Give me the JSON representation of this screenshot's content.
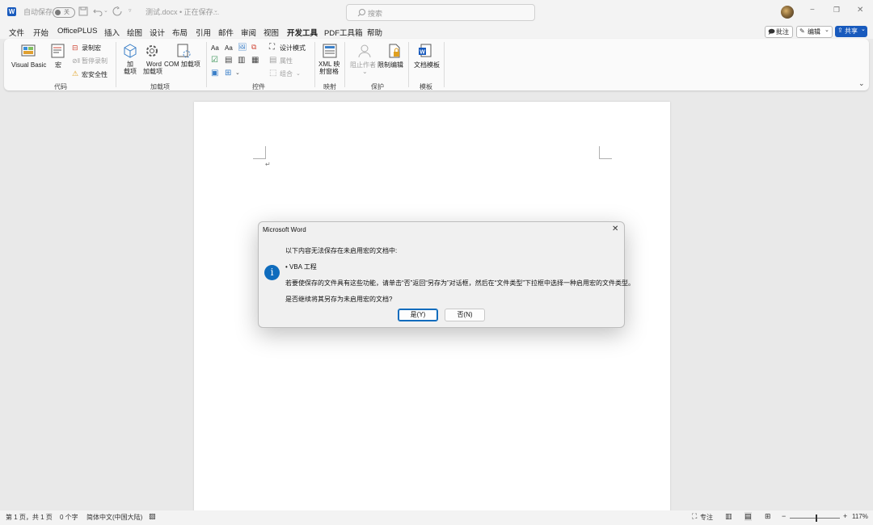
{
  "titlebar": {
    "autosave_label": "自动保存",
    "autosave_state": "关",
    "document_title": "测试.docx • 正在保存...",
    "search_placeholder": "搜索",
    "minimize": "−",
    "restore": "❐",
    "close": "✕"
  },
  "menu": {
    "tabs": [
      "文件",
      "开始",
      "OfficePLUS",
      "插入",
      "绘图",
      "设计",
      "布局",
      "引用",
      "邮件",
      "审阅",
      "视图",
      "开发工具",
      "PDF工具箱",
      "帮助"
    ],
    "active_tab": "开发工具",
    "comments_label": "批注",
    "edit_label": "编辑",
    "share_label": "共享"
  },
  "ribbon": {
    "code": {
      "label": "代码",
      "visual_basic": "Visual Basic",
      "macros": "宏",
      "record_macro": "录制宏",
      "pause_recording": "暂停录制",
      "macro_security": "宏安全性"
    },
    "addins": {
      "label": "加载项",
      "addins_line1": "加",
      "addins_line2": "载项",
      "word_addins_line1": "Word",
      "word_addins_line2": "加载项",
      "com_addins": "COM 加载项"
    },
    "controls": {
      "label": "控件",
      "design_mode": "设计模式",
      "properties": "属性",
      "group": "组合"
    },
    "mapping": {
      "label": "映射",
      "xml_line1": "XML 映",
      "xml_line2": "射窗格"
    },
    "protect": {
      "label": "保护",
      "block_authors": "阻止作者",
      "restrict_editing": "限制编辑"
    },
    "templates": {
      "label": "模板",
      "document_template": "文档模板"
    }
  },
  "statusbar": {
    "page_info": "第 1 页，共 1 页",
    "word_count": "0 个字",
    "language": "简体中文(中国大陆)",
    "focus": "专注",
    "zoom_minus": "−",
    "zoom_plus": "+",
    "zoom": "117%",
    "zoom_percent": 117
  },
  "dialog": {
    "title": "Microsoft Word",
    "line1": "以下内容无法保存在未启用宏的文档中:",
    "bullet": "• VBA 工程",
    "line2": "若要使保存的文件具有这些功能，请单击“否”返回“另存为”对话框，然后在“文件类型”下拉框中选择一种启用宏的文件类型。",
    "line3": "是否继续将其另存为未启用宏的文档?",
    "yes_button": "是(Y)",
    "no_button": "否(N)",
    "colors": {
      "info_icon": "#0f6cbd",
      "accent": "#185abd"
    }
  },
  "document": {
    "paragraph_mark": "↵"
  }
}
